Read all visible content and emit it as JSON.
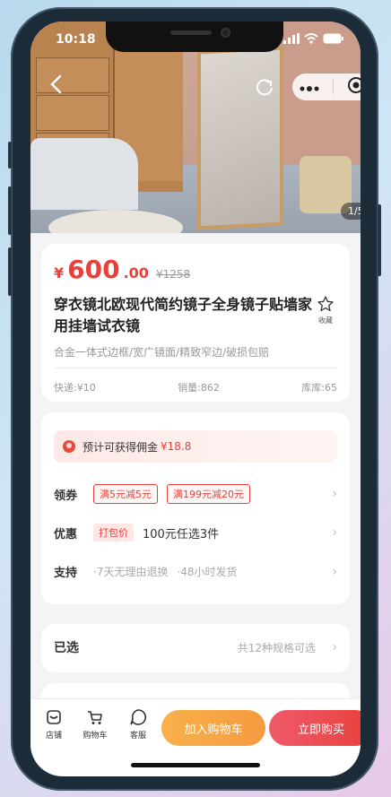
{
  "status": {
    "time": "10:18"
  },
  "hero": {
    "counter": "1/5"
  },
  "product": {
    "price_symbol": "¥",
    "price_int": "600",
    "price_dec": ".00",
    "price_old": "¥1258",
    "title": "穿衣镜北欧现代简约镜子全身镜子贴墙家用挂墙试衣镜",
    "fav_label": "收藏",
    "subtitle": "合金一体式边框/宽广镜面/精致窄边/破损包赔",
    "shipping": "快递:¥10",
    "sales": "销量:862",
    "stock": "库库:65"
  },
  "commission": {
    "text": "预计可获得佣金",
    "amount": "¥18.8"
  },
  "coupons": {
    "label": "领券",
    "items": [
      "满5元减5元",
      "满199元减20元"
    ]
  },
  "discount": {
    "label": "优惠",
    "tag": "打包价",
    "text": "100元任选3件"
  },
  "support": {
    "label": "支持",
    "items": [
      "·7天无理由退换",
      "·48小时发货"
    ]
  },
  "selected": {
    "label": "已选",
    "hint": "共12种规格可选"
  },
  "bottom_nav": {
    "shop": "店铺",
    "cart": "购物车",
    "service": "客服",
    "add_to_cart": "加入购物车",
    "buy_now": "立即购买"
  },
  "colors": {
    "accent": "#e8403b",
    "orange": "#f59a3f"
  }
}
